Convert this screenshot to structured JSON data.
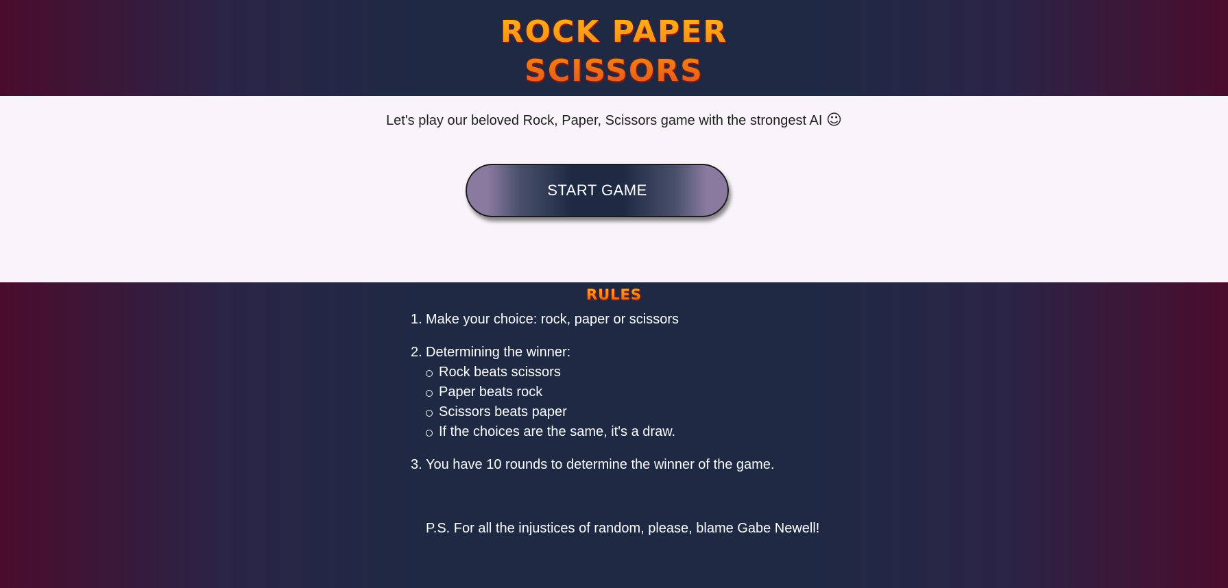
{
  "header": {
    "title_line1": "Rock Paper",
    "title_line2": "Scissors"
  },
  "intro": {
    "tagline": "Let's play our beloved Rock, Paper, Scissors game with the strongest AI",
    "smile": "☺",
    "start_button": "START GAME"
  },
  "rules": {
    "title": "Rules",
    "items": [
      {
        "num": "1.",
        "text": "Make your choice: rock, paper or scissors"
      },
      {
        "num": "2.",
        "text": "Determining the winner:",
        "sub": [
          "Rock beats scissors",
          "Paper beats rock",
          "Scissors beats paper",
          "If the choices are the same, it's a draw."
        ]
      },
      {
        "num": "3.",
        "text": "You have 10 rounds to determine the winner of the game."
      }
    ],
    "ps": "P.S. For all the injustices of random, please, blame Gabe Newell!"
  },
  "colors": {
    "accent_orange": "#f79418",
    "band_center": "#1e2944",
    "band_edge": "#4a0c2c",
    "intro_bg": "#f8f4f9"
  }
}
